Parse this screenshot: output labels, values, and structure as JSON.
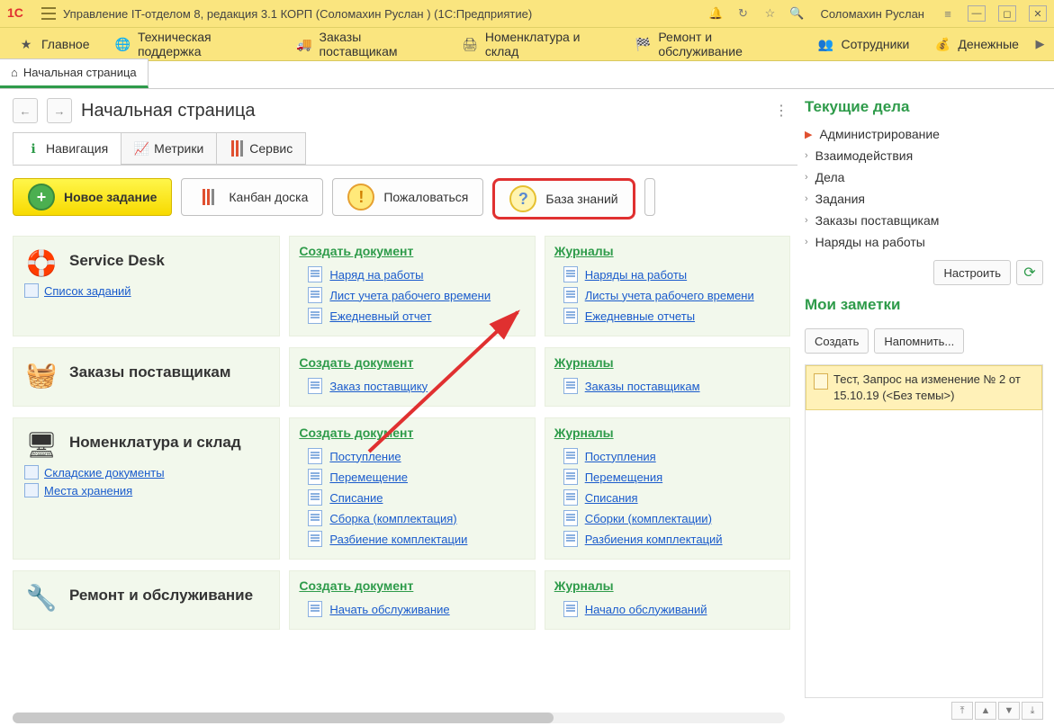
{
  "titlebar": {
    "logo": "1C",
    "title": "Управление IT-отделом 8, редакция 3.1 КОРП (Соломахин Руслан )  (1С:Предприятие)",
    "user": "Соломахин Руслан"
  },
  "mainmenu": {
    "items": [
      {
        "icon": "star",
        "label": "Главное"
      },
      {
        "icon": "globe",
        "label": "Техническая поддержка"
      },
      {
        "icon": "truck",
        "label": "Заказы поставщикам"
      },
      {
        "icon": "printer",
        "label": "Номенклатура и склад"
      },
      {
        "icon": "tools",
        "label": "Ремонт и обслуживание"
      },
      {
        "icon": "people",
        "label": "Сотрудники"
      },
      {
        "icon": "money",
        "label": "Денежные"
      }
    ]
  },
  "tab": {
    "label": "Начальная страница"
  },
  "page": {
    "title": "Начальная страница"
  },
  "inner_tabs": [
    {
      "icon": "info",
      "label": "Навигация",
      "active": true,
      "color": "#2e9b4a"
    },
    {
      "icon": "chart",
      "label": "Метрики",
      "active": false,
      "color": "#3a6ad0"
    },
    {
      "icon": "sliders",
      "label": "Сервис",
      "active": false,
      "color": "#e05030"
    }
  ],
  "buttons": {
    "new_task": "Новое задание",
    "kanban": "Канбан доска",
    "complain": "Пожаловаться",
    "kb": "База знаний"
  },
  "sections": [
    {
      "icon": "lifebuoy",
      "title": "Service Desk",
      "left_links": [
        {
          "label": "Список заданий"
        }
      ],
      "create_label": "Создать документ",
      "create_links": [
        "Наряд на работы",
        "Лист учета рабочего времени",
        "Ежедневный отчет"
      ],
      "journal_label": "Журналы",
      "journal_links": [
        "Наряды на работы",
        "Листы учета рабочего времени",
        "Ежедневные отчеты"
      ]
    },
    {
      "icon": "basket",
      "title": "Заказы поставщикам",
      "left_links": [],
      "create_label": "Создать документ",
      "create_links": [
        "Заказ поставщику"
      ],
      "journal_label": "Журналы",
      "journal_links": [
        "Заказы поставщикам"
      ]
    },
    {
      "icon": "monitor",
      "title": "Номенклатура и склад",
      "left_links": [
        {
          "label": "Складские документы"
        },
        {
          "label": "Места хранения"
        }
      ],
      "create_label": "Создать документ",
      "create_links": [
        "Поступление",
        "Перемещение",
        "Списание",
        "Сборка (комплектация)",
        "Разбиение комплектации"
      ],
      "journal_label": "Журналы",
      "journal_links": [
        "Поступления",
        "Перемещения",
        "Списания",
        "Сборки (комплектации)",
        "Разбиения комплектаций"
      ]
    },
    {
      "icon": "chip",
      "title": "Ремонт и обслуживание",
      "left_links": [],
      "create_label": "Создать документ",
      "create_links": [
        "Начать обслуживание"
      ],
      "journal_label": "Журналы",
      "journal_links": [
        "Начало обслуживаний"
      ]
    }
  ],
  "side": {
    "todo_title": "Текущие дела",
    "todo_items": [
      {
        "label": "Администрирование",
        "red": true
      },
      {
        "label": "Взаимодействия"
      },
      {
        "label": "Дела"
      },
      {
        "label": "Задания"
      },
      {
        "label": "Заказы поставщикам"
      },
      {
        "label": "Наряды на работы"
      }
    ],
    "configure": "Настроить",
    "notes_title": "Мои заметки",
    "create": "Создать",
    "remind": "Напомнить...",
    "note_text": "Тест, Запрос на изменение № 2 от 15.10.19 (<Без темы>)"
  }
}
